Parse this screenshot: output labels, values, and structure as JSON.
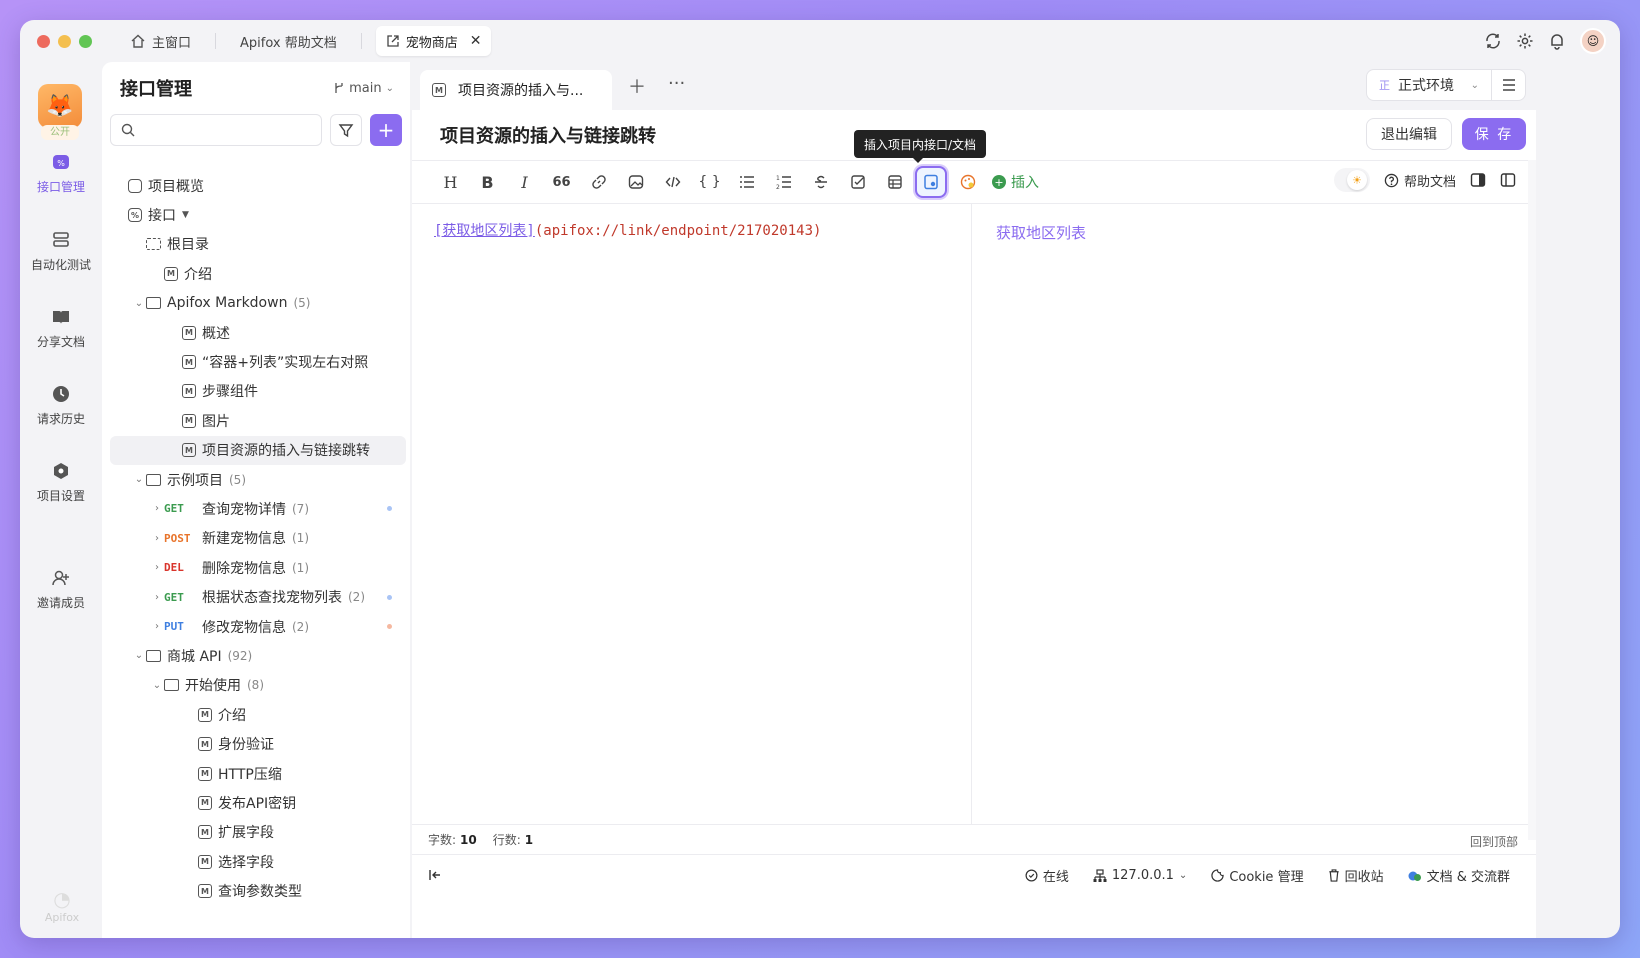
{
  "titlebar": {
    "tabs": [
      {
        "label": "主窗口"
      },
      {
        "label": "Apifox 帮助文档"
      },
      {
        "label": "宠物商店"
      }
    ]
  },
  "rail": {
    "badge": "公开",
    "items": [
      {
        "label": "接口管理"
      },
      {
        "label": "自动化测试"
      },
      {
        "label": "分享文档"
      },
      {
        "label": "请求历史"
      },
      {
        "label": "项目设置"
      },
      {
        "label": "邀请成员"
      }
    ],
    "brand": "Apifox"
  },
  "sidebar": {
    "title": "接口管理",
    "branch": "main",
    "search_placeholder": "",
    "add": "+",
    "tree": [
      {
        "label": "项目概览",
        "kind": "overview",
        "indent": 0
      },
      {
        "label": "接口",
        "kind": "api",
        "indent": 0
      },
      {
        "label": "根目录",
        "kind": "root",
        "indent": 1
      },
      {
        "label": "介绍",
        "kind": "md",
        "indent": 2
      },
      {
        "label": "Apifox Markdown",
        "kind": "folder",
        "count": "(5)",
        "indent": 1,
        "open": true
      },
      {
        "label": "概述",
        "kind": "md",
        "indent": 3
      },
      {
        "label": "“容器+列表”实现左右对照",
        "kind": "md",
        "indent": 3
      },
      {
        "label": "步骤组件",
        "kind": "md",
        "indent": 3
      },
      {
        "label": "图片",
        "kind": "md",
        "indent": 3
      },
      {
        "label": "项目资源的插入与链接跳转",
        "kind": "md",
        "indent": 3,
        "selected": true
      },
      {
        "label": "示例项目",
        "kind": "folder",
        "count": "(5)",
        "indent": 1,
        "open": true
      },
      {
        "label": "查询宠物详情",
        "kind": "endpoint",
        "method": "GET",
        "count": "(7)",
        "indent": 2,
        "dot": "#a9c4f5"
      },
      {
        "label": "新建宠物信息",
        "kind": "endpoint",
        "method": "POST",
        "count": "(1)",
        "indent": 2
      },
      {
        "label": "删除宠物信息",
        "kind": "endpoint",
        "method": "DEL",
        "count": "(1)",
        "indent": 2
      },
      {
        "label": "根据状态查找宠物列表",
        "kind": "endpoint",
        "method": "GET",
        "count": "(2)",
        "indent": 2,
        "dot": "#a9c4f5"
      },
      {
        "label": "修改宠物信息",
        "kind": "endpoint",
        "method": "PUT",
        "count": "(2)",
        "indent": 2,
        "dot": "#f5b8a0"
      },
      {
        "label": "商城 API",
        "kind": "folder",
        "count": "(92)",
        "indent": 1,
        "open": true
      },
      {
        "label": "开始使用",
        "kind": "folder",
        "count": "(8)",
        "indent": 2,
        "open": true
      },
      {
        "label": "介绍",
        "kind": "md",
        "indent": 4
      },
      {
        "label": "身份验证",
        "kind": "md",
        "indent": 4
      },
      {
        "label": "HTTP压缩",
        "kind": "md",
        "indent": 4
      },
      {
        "label": "发布API密钥",
        "kind": "md",
        "indent": 4
      },
      {
        "label": "扩展字段",
        "kind": "md",
        "indent": 4
      },
      {
        "label": "选择字段",
        "kind": "md",
        "indent": 4
      },
      {
        "label": "查询参数类型",
        "kind": "md",
        "indent": 4
      }
    ]
  },
  "methods": {
    "GET": "#3b9b4f",
    "POST": "#e8742b",
    "DEL": "#d9342b",
    "PUT": "#3f7fe0"
  },
  "main": {
    "tab_label": "项目资源的插入与...",
    "env_badge": "正",
    "env_label": "正式环境",
    "doc_title": "项目资源的插入与链接跳转",
    "exit_label": "退出编辑",
    "save_label": "保 存",
    "tooltip": "插入项目内接口/文档",
    "insert_label": "插入",
    "help_label": "帮助文档",
    "editor": {
      "link_text": "[获取地区列表]",
      "url_text": "(apifox://link/endpoint/217020143)"
    },
    "preview_link": "获取地区列表",
    "status": {
      "chars_label": "字数:",
      "chars": "10",
      "lines_label": "行数:",
      "lines": "1",
      "back_top": "回到顶部"
    },
    "footer": {
      "online": "在线",
      "server": "127.0.0.1",
      "cookie": "Cookie 管理",
      "trash": "回收站",
      "community": "文档 & 交流群"
    }
  },
  "colors": {
    "accent": "#8b6cf0",
    "link": "#7b5ce6",
    "url": "#c0392b"
  }
}
